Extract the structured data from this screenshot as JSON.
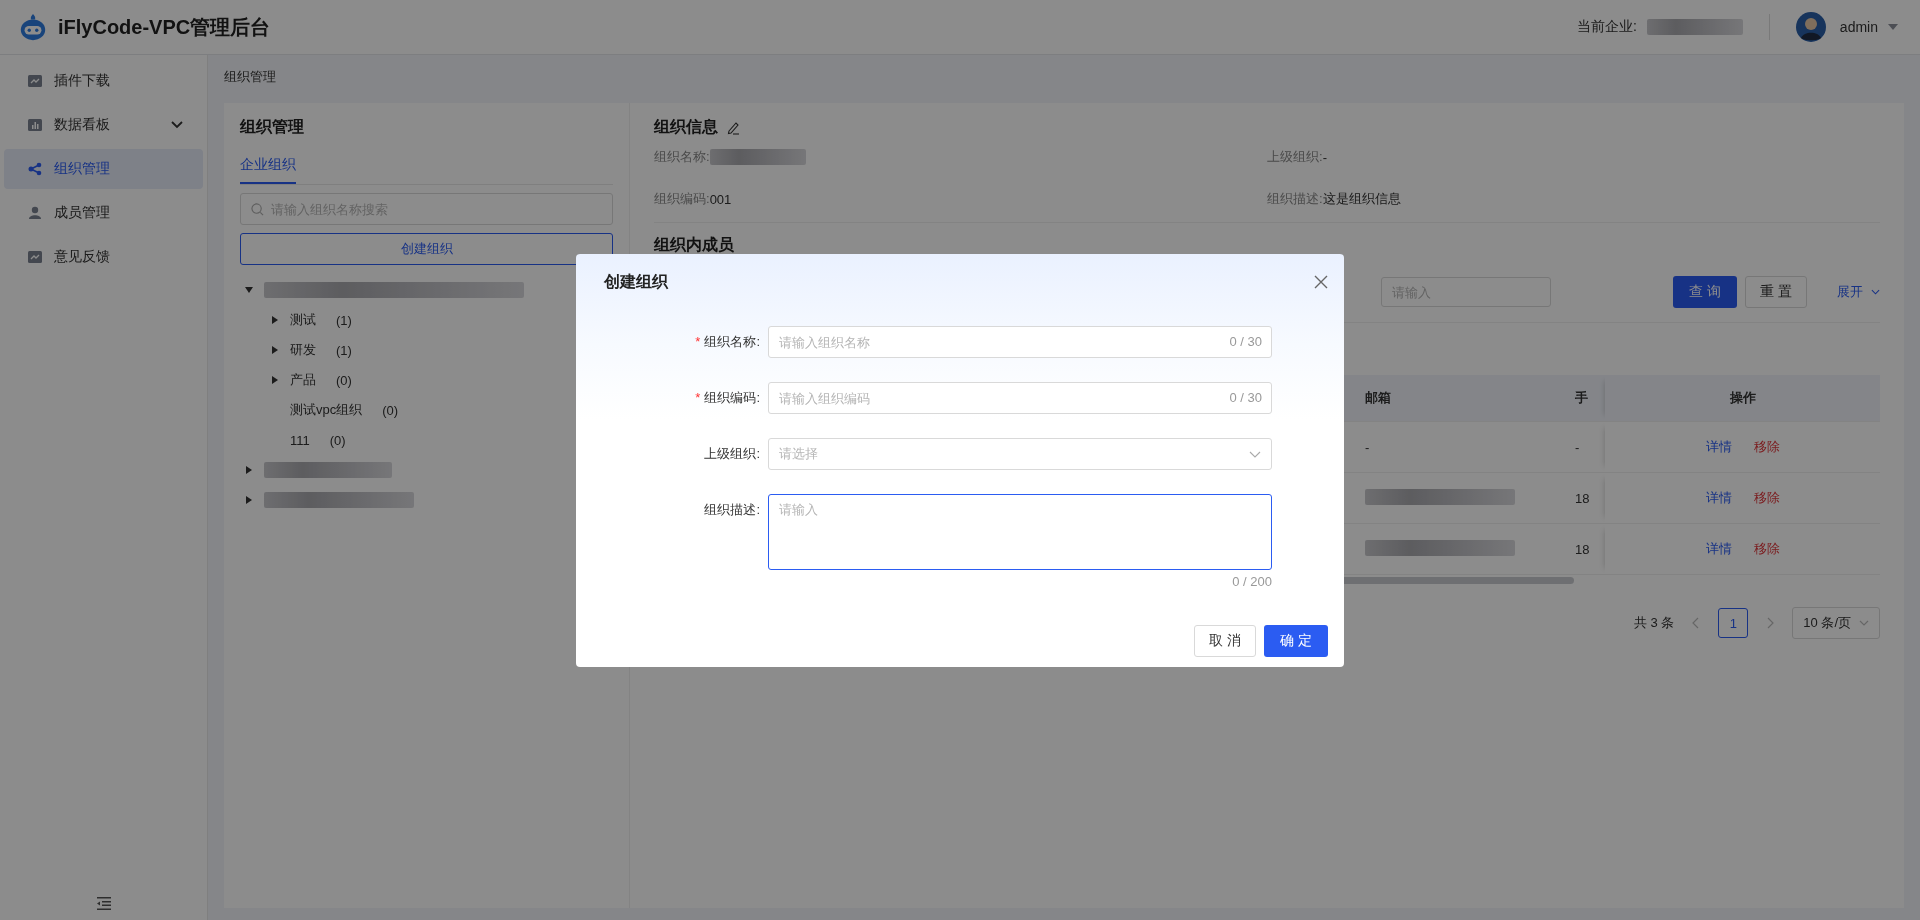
{
  "header": {
    "title": "iFlyCode-VPC管理后台",
    "company_label": "当前企业:",
    "user": "admin"
  },
  "sidebar": {
    "items": [
      {
        "label": "插件下载",
        "selected": false,
        "has_submenu": false
      },
      {
        "label": "数据看板",
        "selected": false,
        "has_submenu": true
      },
      {
        "label": "组织管理",
        "selected": true,
        "has_submenu": false
      },
      {
        "label": "成员管理",
        "selected": false,
        "has_submenu": false
      },
      {
        "label": "意见反馈",
        "selected": false,
        "has_submenu": false
      }
    ]
  },
  "breadcrumb": "组织管理",
  "org_panel": {
    "title": "组织管理",
    "tabs": [
      {
        "label": "企业组织",
        "selected": true
      }
    ],
    "search": {
      "placeholder": "请输入组织名称搜索"
    },
    "create_button": "创建组织",
    "tree": [
      {
        "kind": "blurred",
        "expanded": true,
        "children": [
          {
            "label": "测试",
            "count": "(1)",
            "expanded": false,
            "has_children": true
          },
          {
            "label": "研发",
            "count": "(1)",
            "expanded": false,
            "has_children": true
          },
          {
            "label": "产品",
            "count": "(0)",
            "expanded": false,
            "has_children": true
          },
          {
            "label": "测试vpc组织",
            "count": "(0)",
            "has_children": false
          },
          {
            "label": "111",
            "count": "(0)",
            "has_children": false
          }
        ]
      },
      {
        "kind": "blurred",
        "expanded": false
      },
      {
        "kind": "blurred",
        "expanded": false
      }
    ]
  },
  "info": {
    "title": "组织信息",
    "fields": [
      {
        "label": "组织名称:",
        "blurred": true
      },
      {
        "label": "上级组织:",
        "value": "-",
        "blurred": false
      },
      {
        "label": "组织编码:",
        "value": "001",
        "blurred": false
      },
      {
        "label": "组织描述:",
        "value": "这是组织信息",
        "blurred": false
      }
    ]
  },
  "members": {
    "title": "组织内成员",
    "filter": {
      "placeholder": "请输入"
    },
    "query_button": "查 询",
    "reset_button": "重 置",
    "expand_link": "展开",
    "table": {
      "columns": [
        "邮箱",
        "手",
        "操作"
      ],
      "rows": [
        {
          "email": "-",
          "email_blurred": false,
          "phone": "-",
          "actions": [
            "详情",
            "移除"
          ]
        },
        {
          "email_blurred": true,
          "phone": "18",
          "actions": [
            "详情",
            "移除"
          ]
        },
        {
          "email_blurred": true,
          "phone": "18",
          "actions": [
            "详情",
            "移除"
          ]
        }
      ]
    },
    "pagination": {
      "total": "共 3 条",
      "pages": [
        {
          "label": "1",
          "selected": true
        }
      ],
      "page_size": "10 条/页"
    }
  },
  "dialog": {
    "title": "创建组织",
    "fields": [
      {
        "kind": "input",
        "label": "组织名称:",
        "required_mark": "*",
        "placeholder": "请输入组织名称",
        "counter": "0 / 30"
      },
      {
        "kind": "input",
        "label": "组织编码:",
        "required_mark": "*",
        "placeholder": "请输入组织编码",
        "counter": "0 / 30"
      },
      {
        "kind": "select",
        "label": "上级组织:",
        "placeholder": "请选择"
      },
      {
        "kind": "textarea",
        "label": "组织描述:",
        "placeholder": "请输入",
        "counter": "0 / 200",
        "focused": true
      }
    ],
    "cancel_button": "取 消",
    "ok_button": "确 定"
  }
}
